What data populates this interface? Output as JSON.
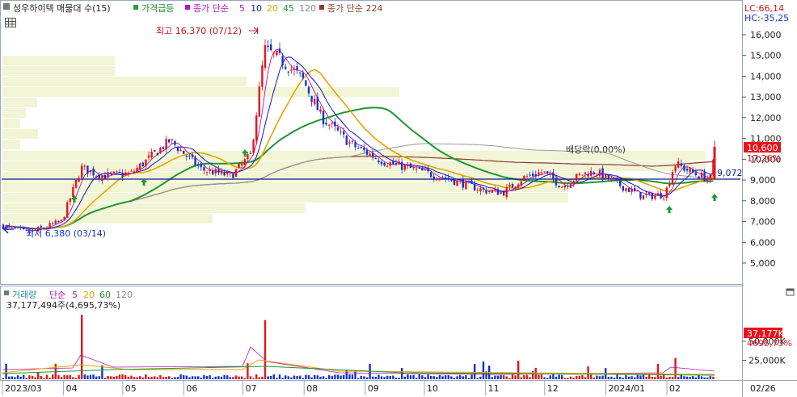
{
  "legend": {
    "title": "성우하이텍 매물대 수(15)",
    "item1": "가격급등",
    "item2_prefix": "종가 단순",
    "ma_periods": [
      "5",
      "10",
      "20",
      "45",
      "120"
    ],
    "item3": "종가 단순 224"
  },
  "volume_legend": {
    "label": "거래량",
    "prefix": "단순",
    "periods": [
      "5",
      "20",
      "60",
      "120"
    ],
    "current": "37,177,494주(4,695,73%)"
  },
  "right_info": {
    "lc": "LC:66,14",
    "hc": "HC:-35,25"
  },
  "annotations": {
    "high": "최고 16,370 (07/12)",
    "low": "최저 6,380 (03/14)",
    "dividend": "배당락(0,00%)",
    "horizontal_line": "9,072"
  },
  "price_badges": {
    "price": "10,600",
    "change": "17,26%"
  },
  "volume_badges": {
    "value": "37,177K",
    "change": "4695,73%"
  },
  "colors": {
    "up": "#e8141c",
    "down": "#1434d2",
    "ma5": "#b414b4",
    "ma10": "#1414d2",
    "ma20": "#e6a400",
    "ma45": "#1e9632",
    "ma120": "#999999",
    "ma224": "#8c3c28"
  },
  "chart_data": {
    "type": "candlestick",
    "price_axis": {
      "ticks": [
        "16,000",
        "15,000",
        "14,000",
        "13,000",
        "12,000",
        "11,000",
        "10,000",
        "9,000",
        "8,000",
        "7,000",
        "6,000",
        "5,000"
      ],
      "range": [
        4300,
        16800
      ]
    },
    "volume_axis": {
      "ticks": [
        "50,000K",
        "25,000K"
      ],
      "range": [
        0,
        90000
      ]
    },
    "x_labels": [
      "2023/03",
      "04",
      "05",
      "06",
      "07",
      "08",
      "09",
      "10",
      "11",
      "12",
      "2024/01",
      "02"
    ],
    "x_end_label": "02/26",
    "key_points": [
      {
        "date": "2023-03-14",
        "value": 6380,
        "note": "low"
      },
      {
        "date": "2023-07-12",
        "value": 16370,
        "note": "high"
      },
      {
        "date": "2024-02-26",
        "value": 10600,
        "note": "last close"
      }
    ],
    "close_path": [
      [
        "2023-03-01",
        6800
      ],
      [
        "2023-03-14",
        6450
      ],
      [
        "2023-03-31",
        7000
      ],
      [
        "2023-04-10",
        9600
      ],
      [
        "2023-04-20",
        9200
      ],
      [
        "2023-05-05",
        9300
      ],
      [
        "2023-05-25",
        10900
      ],
      [
        "2023-06-10",
        9500
      ],
      [
        "2023-06-25",
        9200
      ],
      [
        "2023-07-05",
        10200
      ],
      [
        "2023-07-12",
        15300
      ],
      [
        "2023-07-20",
        14800
      ],
      [
        "2023-07-31",
        13900
      ],
      [
        "2023-08-10",
        12000
      ],
      [
        "2023-08-25",
        10700
      ],
      [
        "2023-09-10",
        9900
      ],
      [
        "2023-09-30",
        9400
      ],
      [
        "2023-10-15",
        9000
      ],
      [
        "2023-10-31",
        8500
      ],
      [
        "2023-11-10",
        8400
      ],
      [
        "2023-11-20",
        9100
      ],
      [
        "2023-11-30",
        9400
      ],
      [
        "2023-12-10",
        8700
      ],
      [
        "2023-12-20",
        9300
      ],
      [
        "2023-12-27",
        9400
      ],
      [
        "2024-01-05",
        8900
      ],
      [
        "2024-01-20",
        8200
      ],
      [
        "2024-01-31",
        8300
      ],
      [
        "2024-02-05",
        9800
      ],
      [
        "2024-02-15",
        9300
      ],
      [
        "2024-02-23",
        9050
      ],
      [
        "2024-02-26",
        10600
      ]
    ],
    "volume_spikes": [
      {
        "date": "2023-04-10",
        "value": 85000
      },
      {
        "date": "2023-07-12",
        "value": 78000
      },
      {
        "date": "2024-02-05",
        "value": 28000
      },
      {
        "date": "2024-02-26",
        "value": 37177
      }
    ]
  }
}
